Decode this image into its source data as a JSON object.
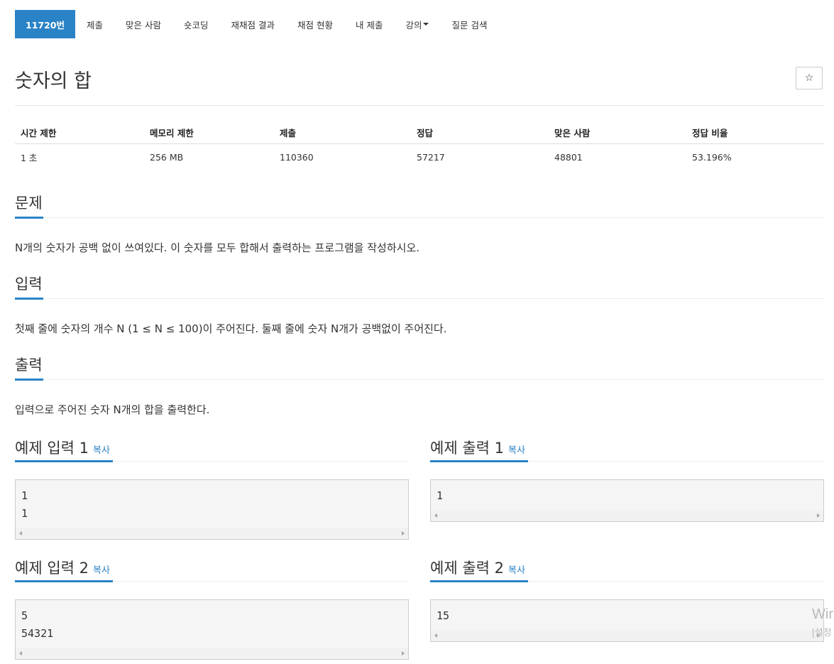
{
  "nav": {
    "active_tab": "11720번",
    "tabs": [
      "제출",
      "맞은 사람",
      "숏코딩",
      "재채점 결과",
      "채점 현황",
      "내 제출",
      "강의",
      "질문 검색"
    ]
  },
  "problem": {
    "title": "숫자의 합",
    "star_icon": "☆"
  },
  "info_table": {
    "headers": [
      "시간 제한",
      "메모리 제한",
      "제출",
      "정답",
      "맞은 사람",
      "정답 비율"
    ],
    "values": [
      "1 초",
      "256 MB",
      "110360",
      "57217",
      "48801",
      "53.196%"
    ]
  },
  "sections": {
    "problem_heading": "문제",
    "problem_text": "N개의 숫자가 공백 없이 쓰여있다. 이 숫자를 모두 합해서 출력하는 프로그램을 작성하시오.",
    "input_heading": "입력",
    "input_text": "첫째 줄에 숫자의 개수 N (1 ≤ N ≤ 100)이 주어진다. 둘째 줄에 숫자 N개가 공백없이 주어진다.",
    "output_heading": "출력",
    "output_text": "입력으로 주어진 숫자 N개의 합을 출력한다."
  },
  "samples": {
    "copy_label": "복사",
    "input1_title": "예제 입력 1",
    "input1_lines": [
      "1",
      "1"
    ],
    "output1_title": "예제 출력 1",
    "output1_lines": [
      "1"
    ],
    "input2_title": "예제 입력 2",
    "input2_lines": [
      "5",
      "54321"
    ],
    "output2_title": "예제 출력 2",
    "output2_lines": [
      "15"
    ]
  },
  "watermark": {
    "line1": "Wir",
    "line2": "[설정"
  },
  "colors": {
    "accent": "#2a83c6",
    "sample_bg": "#f5f5f5"
  }
}
